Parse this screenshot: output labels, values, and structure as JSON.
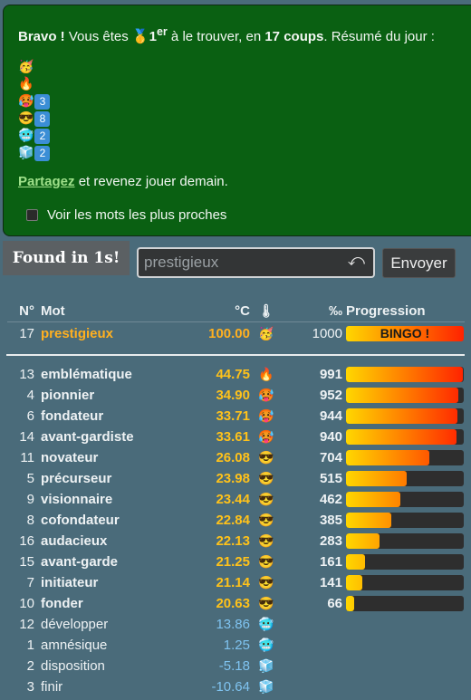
{
  "summary": {
    "bravo": "Bravo !",
    "text_a": " Vous êtes ",
    "medal": "🥇",
    "rank": "1",
    "rank_sup": "er",
    "text_b": " à le trouver, en ",
    "coups": "17 coups",
    "text_c": ". Résumé du jour :",
    "emoji_lines": [
      {
        "emoji": "🥳",
        "count": ""
      },
      {
        "emoji": "🔥",
        "count": ""
      },
      {
        "emoji": "🥵",
        "count": "3"
      },
      {
        "emoji": "😎",
        "count": "8"
      },
      {
        "emoji": "🥶",
        "count": "2"
      },
      {
        "emoji": "🧊",
        "count": "2"
      }
    ],
    "share_link": "Partagez",
    "share_rest": " et revenez jouer demain.",
    "closest_label": "Voir les mots les plus proches"
  },
  "found_label": "Found in 1s!",
  "search": {
    "placeholder": "prestigieux",
    "undo_icon": "⤺"
  },
  "send_label": "Envoyer",
  "table": {
    "headers": {
      "num": "N°",
      "word": "Mot",
      "temp": "°C",
      "thermo": "🌡",
      "permil": "‰",
      "progress": "Progression"
    },
    "winner": {
      "num": "17",
      "word": "prestigieux",
      "temp": "100.00",
      "emoji": "🥳",
      "permil": "1000",
      "bingo": "BINGO !"
    },
    "rows": [
      {
        "num": "13",
        "word": "emblématique",
        "temp": "44.75",
        "emoji": "🔥",
        "permil": "991",
        "progress": 99.1,
        "hot": true
      },
      {
        "num": "4",
        "word": "pionnier",
        "temp": "34.90",
        "emoji": "🥵",
        "permil": "952",
        "progress": 95.2,
        "hot": true
      },
      {
        "num": "6",
        "word": "fondateur",
        "temp": "33.71",
        "emoji": "🥵",
        "permil": "944",
        "progress": 94.4,
        "hot": true
      },
      {
        "num": "14",
        "word": "avant-gardiste",
        "temp": "33.61",
        "emoji": "🥵",
        "permil": "940",
        "progress": 94.0,
        "hot": true
      },
      {
        "num": "11",
        "word": "novateur",
        "temp": "26.08",
        "emoji": "😎",
        "permil": "704",
        "progress": 70.4,
        "hot": true
      },
      {
        "num": "5",
        "word": "précurseur",
        "temp": "23.98",
        "emoji": "😎",
        "permil": "515",
        "progress": 51.5,
        "hot": true
      },
      {
        "num": "9",
        "word": "visionnaire",
        "temp": "23.44",
        "emoji": "😎",
        "permil": "462",
        "progress": 46.2,
        "hot": true
      },
      {
        "num": "8",
        "word": "cofondateur",
        "temp": "22.84",
        "emoji": "😎",
        "permil": "385",
        "progress": 38.5,
        "hot": true
      },
      {
        "num": "16",
        "word": "audacieux",
        "temp": "22.13",
        "emoji": "😎",
        "permil": "283",
        "progress": 28.3,
        "hot": true
      },
      {
        "num": "15",
        "word": "avant-garde",
        "temp": "21.25",
        "emoji": "😎",
        "permil": "161",
        "progress": 16.1,
        "hot": true
      },
      {
        "num": "7",
        "word": "initiateur",
        "temp": "21.14",
        "emoji": "😎",
        "permil": "141",
        "progress": 14.1,
        "hot": true
      },
      {
        "num": "10",
        "word": "fonder",
        "temp": "20.63",
        "emoji": "😎",
        "permil": "66",
        "progress": 6.6,
        "hot": true
      },
      {
        "num": "12",
        "word": "développer",
        "temp": "13.86",
        "emoji": "🥶",
        "permil": "",
        "progress": null,
        "hot": false
      },
      {
        "num": "1",
        "word": "amnésique",
        "temp": "1.25",
        "emoji": "🥶",
        "permil": "",
        "progress": null,
        "hot": false
      },
      {
        "num": "2",
        "word": "disposition",
        "temp": "-5.18",
        "emoji": "🧊",
        "permil": "",
        "progress": null,
        "hot": false
      },
      {
        "num": "3",
        "word": "finir",
        "temp": "-10.64",
        "emoji": "🧊",
        "permil": "",
        "progress": null,
        "hot": false
      }
    ]
  }
}
